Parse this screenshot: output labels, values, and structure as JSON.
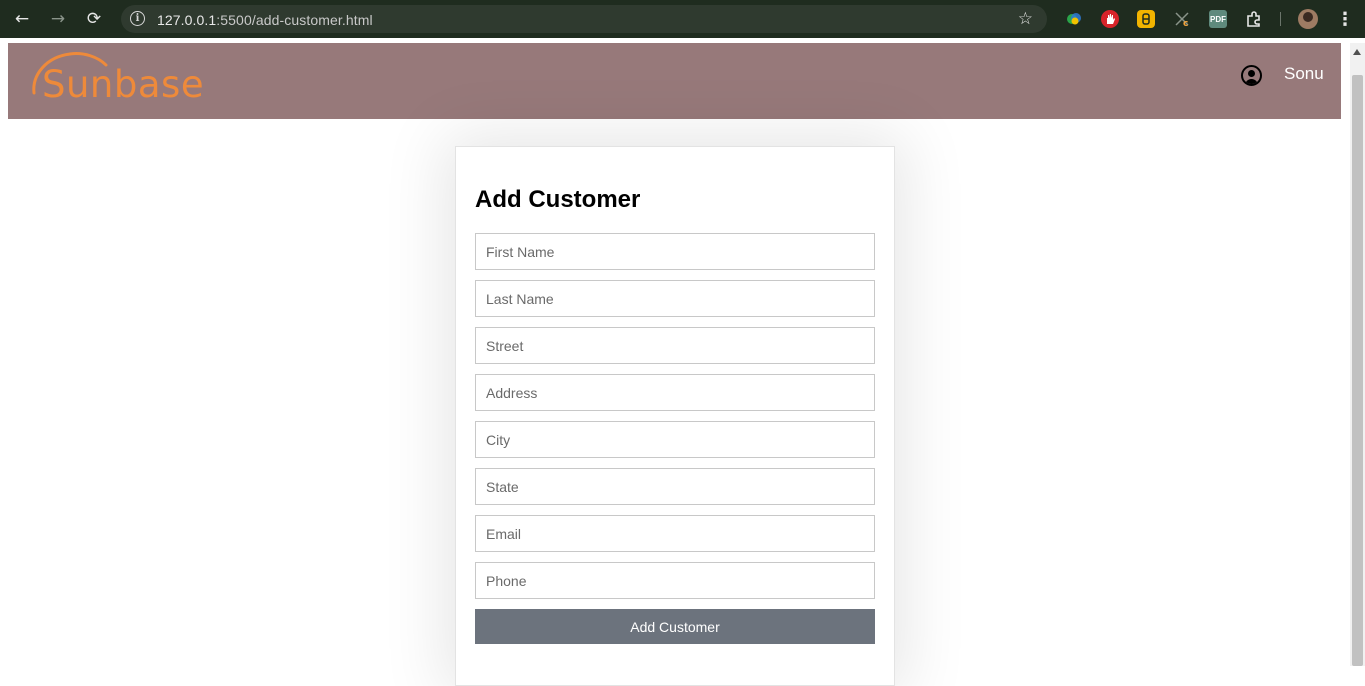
{
  "browser": {
    "url_host": "127.0.0.1",
    "url_path": ":5500/add-customer.html",
    "back_icon": "←",
    "forward_icon": "→",
    "reload_icon": "⟳",
    "info_icon": "i",
    "star_icon": "☆",
    "menu_icon": "⋮",
    "extensions": [
      {
        "name": "chrome-pinned-extension-1",
        "glyph": "◆",
        "color": "#2aa54a"
      },
      {
        "name": "adblock-extension",
        "glyph": "✋",
        "color": "#d8232a"
      },
      {
        "name": "yellow-extension",
        "glyph": "▮",
        "color": "#f2b400"
      },
      {
        "name": "cookie-extension",
        "glyph": "c",
        "color": "#3b4a3b"
      },
      {
        "name": "pdf-extension",
        "glyph": "PDF",
        "color": "#5f8a7d"
      },
      {
        "name": "extensions-puzzle",
        "glyph": "⧉",
        "color": "#1f2c1f"
      }
    ]
  },
  "header": {
    "logo_text": "Sunbase",
    "user_name": "Sonu"
  },
  "form": {
    "title": "Add Customer",
    "fields": [
      {
        "name": "first-name",
        "placeholder": "First Name"
      },
      {
        "name": "last-name",
        "placeholder": "Last Name"
      },
      {
        "name": "street",
        "placeholder": "Street"
      },
      {
        "name": "address",
        "placeholder": "Address"
      },
      {
        "name": "city",
        "placeholder": "City"
      },
      {
        "name": "state",
        "placeholder": "State"
      },
      {
        "name": "email",
        "placeholder": "Email"
      },
      {
        "name": "phone",
        "placeholder": "Phone"
      }
    ],
    "submit_label": "Add Customer"
  },
  "colors": {
    "header_bg": "#97797a",
    "logo": "#ee8a3a",
    "button_bg": "#6c737d",
    "browser_bg": "#1f2c1f"
  }
}
